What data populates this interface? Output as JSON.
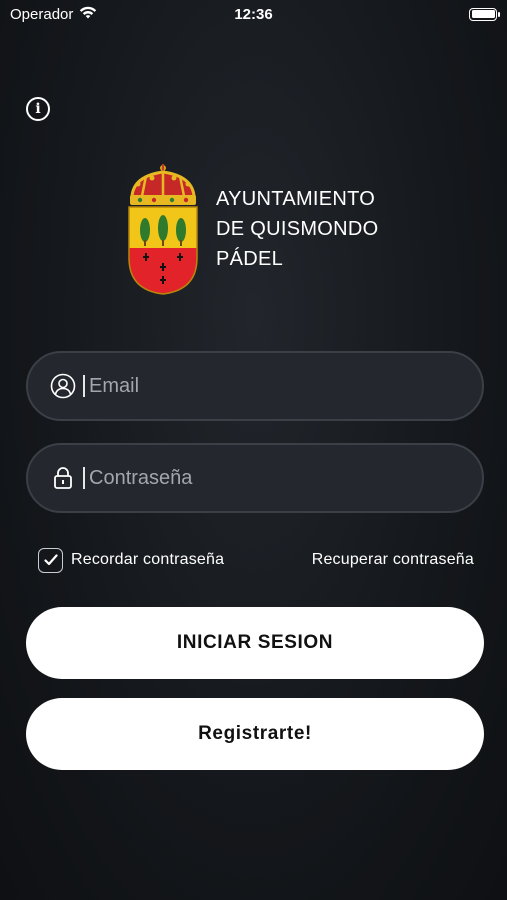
{
  "status_bar": {
    "carrier": "Operador",
    "time": "12:36"
  },
  "logo": {
    "line1": "AYUNTAMIENTO",
    "line2": "DE QUISMONDO",
    "line3": "PÁDEL",
    "colors": {
      "crown": "#d7a21a",
      "shield_top": "#f2c619",
      "shield_bottom": "#e3232a",
      "trees": "#2f7a2d"
    }
  },
  "form": {
    "email_placeholder": "Email",
    "password_placeholder": "Contraseña",
    "remember_label": "Recordar contraseña",
    "remember_checked": true,
    "recover_label": "Recuperar contraseña"
  },
  "buttons": {
    "login": "INICIAR SESION",
    "register": "Registrarte!"
  },
  "icons": [
    "info-icon",
    "user-icon",
    "lock-icon",
    "check-icon",
    "wifi-icon",
    "battery-icon"
  ]
}
